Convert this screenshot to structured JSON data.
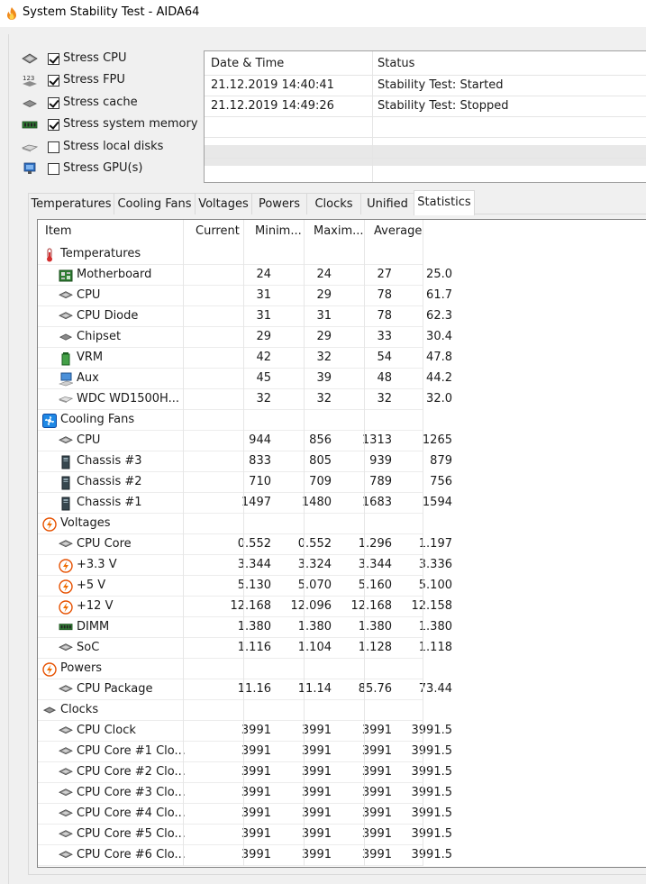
{
  "window": {
    "title": "System Stability Test - AIDA64"
  },
  "stress_options": [
    {
      "label": "Stress CPU",
      "checked": true,
      "icon": "cpu-chip-icon"
    },
    {
      "label": "Stress FPU",
      "checked": true,
      "icon": "fpu-123-icon"
    },
    {
      "label": "Stress cache",
      "checked": true,
      "icon": "cache-chip-icon"
    },
    {
      "label": "Stress system memory",
      "checked": true,
      "icon": "memory-module-icon"
    },
    {
      "label": "Stress local disks",
      "checked": false,
      "icon": "disk-drive-icon"
    },
    {
      "label": "Stress GPU(s)",
      "checked": false,
      "icon": "gpu-monitor-icon"
    }
  ],
  "log": {
    "headers": {
      "datetime": "Date & Time",
      "status": "Status"
    },
    "rows": [
      {
        "datetime": "21.12.2019 14:40:41",
        "status": "Stability Test: Started"
      },
      {
        "datetime": "21.12.2019 14:49:26",
        "status": "Stability Test: Stopped"
      }
    ]
  },
  "tabs": [
    {
      "label": "Temperatures",
      "active": false
    },
    {
      "label": "Cooling Fans",
      "active": false
    },
    {
      "label": "Voltages",
      "active": false
    },
    {
      "label": "Powers",
      "active": false
    },
    {
      "label": "Clocks",
      "active": false
    },
    {
      "label": "Unified",
      "active": false
    },
    {
      "label": "Statistics",
      "active": true
    }
  ],
  "stats": {
    "headers": {
      "item": "Item",
      "current": "Current",
      "minimum": "Minim...",
      "maximum": "Maxim...",
      "average": "Average"
    },
    "rows": [
      {
        "type": "group",
        "name": "Temperatures",
        "icon": "thermometer-icon"
      },
      {
        "type": "item",
        "name": "Motherboard",
        "icon": "motherboard-icon",
        "current": "24",
        "minimum": "24",
        "maximum": "27",
        "average": "25.0"
      },
      {
        "type": "item",
        "name": "CPU",
        "icon": "cpu-chip-icon",
        "current": "31",
        "minimum": "29",
        "maximum": "78",
        "average": "61.7"
      },
      {
        "type": "item",
        "name": "CPU Diode",
        "icon": "cpu-chip-icon",
        "current": "31",
        "minimum": "31",
        "maximum": "78",
        "average": "62.3"
      },
      {
        "type": "item",
        "name": "Chipset",
        "icon": "chipset-icon",
        "current": "29",
        "minimum": "29",
        "maximum": "33",
        "average": "30.4"
      },
      {
        "type": "item",
        "name": "VRM",
        "icon": "vrm-battery-icon",
        "current": "42",
        "minimum": "32",
        "maximum": "54",
        "average": "47.8"
      },
      {
        "type": "item",
        "name": "Aux",
        "icon": "aux-computer-icon",
        "current": "45",
        "minimum": "39",
        "maximum": "48",
        "average": "44.2"
      },
      {
        "type": "item",
        "name": "WDC WD1500H...",
        "icon": "disk-drive-icon",
        "current": "32",
        "minimum": "32",
        "maximum": "32",
        "average": "32.0"
      },
      {
        "type": "group",
        "name": "Cooling Fans",
        "icon": "fan-icon"
      },
      {
        "type": "item",
        "name": "CPU",
        "icon": "cpu-chip-icon",
        "current": "944",
        "minimum": "856",
        "maximum": "1313",
        "average": "1265"
      },
      {
        "type": "item",
        "name": "Chassis #3",
        "icon": "chassis-icon",
        "current": "833",
        "minimum": "805",
        "maximum": "939",
        "average": "879"
      },
      {
        "type": "item",
        "name": "Chassis #2",
        "icon": "chassis-icon",
        "current": "710",
        "minimum": "709",
        "maximum": "789",
        "average": "756"
      },
      {
        "type": "item",
        "name": "Chassis #1",
        "icon": "chassis-icon",
        "current": "1497",
        "minimum": "1480",
        "maximum": "1683",
        "average": "1594"
      },
      {
        "type": "group",
        "name": "Voltages",
        "icon": "voltage-bolt-icon"
      },
      {
        "type": "item",
        "name": "CPU Core",
        "icon": "cpu-chip-icon",
        "current": "0.552",
        "minimum": "0.552",
        "maximum": "1.296",
        "average": "1.197"
      },
      {
        "type": "item",
        "name": "+3.3 V",
        "icon": "voltage-bolt-icon",
        "current": "3.344",
        "minimum": "3.324",
        "maximum": "3.344",
        "average": "3.336"
      },
      {
        "type": "item",
        "name": "+5 V",
        "icon": "voltage-bolt-icon",
        "current": "5.130",
        "minimum": "5.070",
        "maximum": "5.160",
        "average": "5.100"
      },
      {
        "type": "item",
        "name": "+12 V",
        "icon": "voltage-bolt-icon",
        "current": "12.168",
        "minimum": "12.096",
        "maximum": "12.168",
        "average": "12.158"
      },
      {
        "type": "item",
        "name": "DIMM",
        "icon": "memory-module-icon",
        "current": "1.380",
        "minimum": "1.380",
        "maximum": "1.380",
        "average": "1.380"
      },
      {
        "type": "item",
        "name": "SoC",
        "icon": "cpu-chip-icon",
        "current": "1.116",
        "minimum": "1.104",
        "maximum": "1.128",
        "average": "1.118"
      },
      {
        "type": "group",
        "name": "Powers",
        "icon": "voltage-bolt-icon"
      },
      {
        "type": "item",
        "name": "CPU Package",
        "icon": "cpu-chip-icon",
        "current": "11.16",
        "minimum": "11.14",
        "maximum": "85.76",
        "average": "73.44"
      },
      {
        "type": "group",
        "name": "Clocks",
        "icon": "clock-chip-icon"
      },
      {
        "type": "item",
        "name": "CPU Clock",
        "icon": "cpu-chip-icon",
        "current": "3991",
        "minimum": "3991",
        "maximum": "3991",
        "average": "3991.5"
      },
      {
        "type": "item",
        "name": "CPU Core #1 Clo...",
        "icon": "cpu-chip-icon",
        "current": "3991",
        "minimum": "3991",
        "maximum": "3991",
        "average": "3991.5"
      },
      {
        "type": "item",
        "name": "CPU Core #2 Clo...",
        "icon": "cpu-chip-icon",
        "current": "3991",
        "minimum": "3991",
        "maximum": "3991",
        "average": "3991.5"
      },
      {
        "type": "item",
        "name": "CPU Core #3 Clo...",
        "icon": "cpu-chip-icon",
        "current": "3991",
        "minimum": "3991",
        "maximum": "3991",
        "average": "3991.5"
      },
      {
        "type": "item",
        "name": "CPU Core #4 Clo...",
        "icon": "cpu-chip-icon",
        "current": "3991",
        "minimum": "3991",
        "maximum": "3991",
        "average": "3991.5"
      },
      {
        "type": "item",
        "name": "CPU Core #5 Clo...",
        "icon": "cpu-chip-icon",
        "current": "3991",
        "minimum": "3991",
        "maximum": "3991",
        "average": "3991.5"
      },
      {
        "type": "item",
        "name": "CPU Core #6 Clo...",
        "icon": "cpu-chip-icon",
        "current": "3991",
        "minimum": "3991",
        "maximum": "3991",
        "average": "3991.5"
      }
    ]
  }
}
